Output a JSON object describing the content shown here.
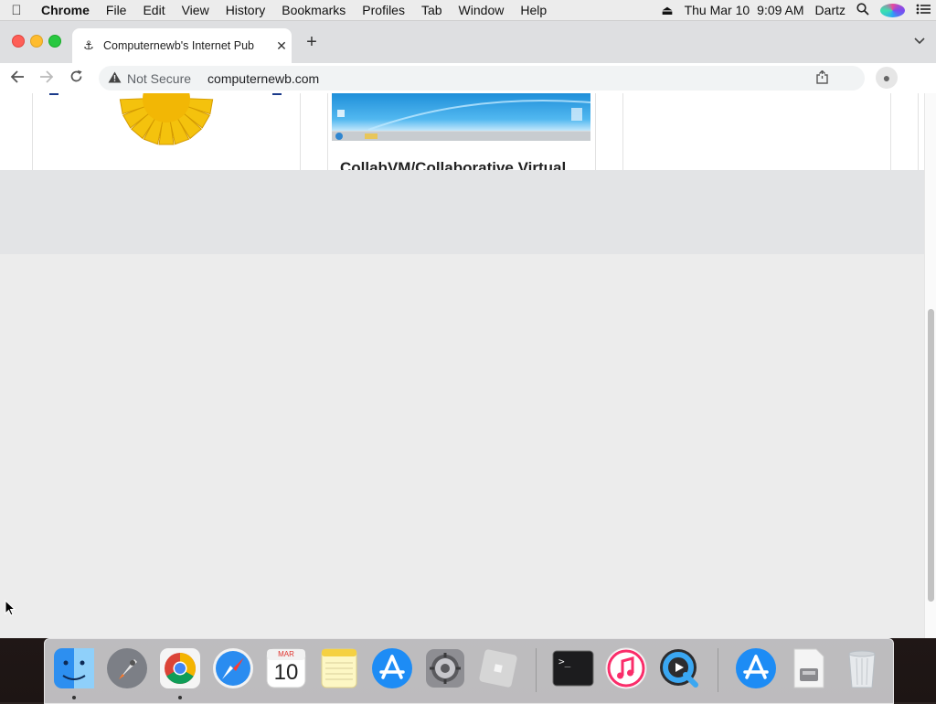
{
  "menubar": {
    "apple_icon": "apple-icon",
    "app_name": "Chrome",
    "menus": [
      "File",
      "Edit",
      "View",
      "History",
      "Bookmarks",
      "Profiles",
      "Tab",
      "Window",
      "Help"
    ],
    "date": "Thu Mar 10",
    "time": "9:09 AM",
    "user": "Dartz"
  },
  "browser": {
    "tab_title": "Computernewb's Internet Pub",
    "tab_close": "✕",
    "new_tab": "+",
    "security_label": "Not Secure",
    "url": "computernewb.com"
  },
  "page": {
    "card_title": "CollabVM/Collaborative Virtual"
  },
  "dock": {
    "calendar_month": "MAR",
    "calendar_day": "10",
    "terminal_prompt": ">_"
  },
  "colors": {
    "accent_blue": "#1a73e8",
    "close_red": "#fe5f57",
    "minimize_yellow": "#febc2e",
    "zoom_green": "#28c840"
  }
}
